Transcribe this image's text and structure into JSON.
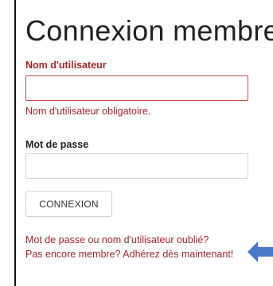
{
  "login": {
    "title": "Connexion membre",
    "username_label": "Nom d'utilisateur",
    "username_value": "",
    "username_error": "Nom d'utilisateur obligatoire.",
    "password_label": "Mot de passe",
    "password_value": "",
    "submit_label": "CONNEXION",
    "forgot_link": "Mot de passe ou nom d'utilisateur oublié?",
    "join_link": "Pas encore membre? Adhérez dès maintenant!"
  },
  "icons": {
    "pointer": "arrow-left-icon"
  },
  "colors": {
    "accent": "#a0282d",
    "error_border": "#c8494f",
    "arrow": "#4a78c8"
  }
}
